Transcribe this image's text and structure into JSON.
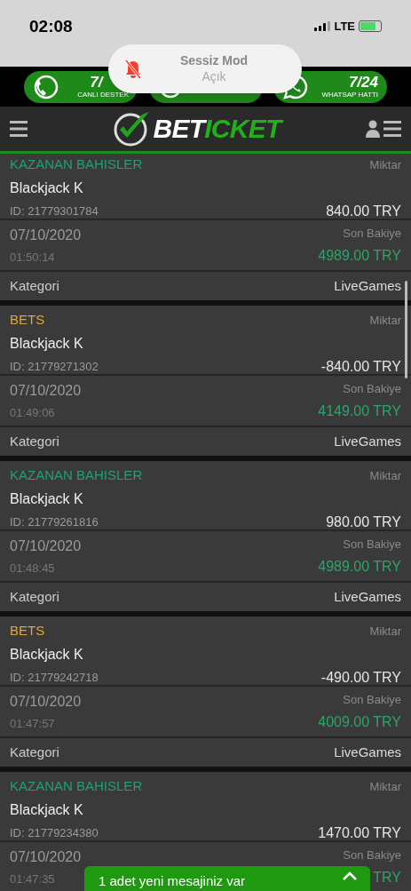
{
  "status_bar": {
    "time": "02:08",
    "network": "LTE"
  },
  "toast": {
    "title": "Sessiz Mod",
    "subtitle": "Açık"
  },
  "promo_bar": [
    {
      "kind": "support",
      "headline": "7/",
      "label": "CANLI DESTEK"
    },
    {
      "kind": "telegram"
    },
    {
      "kind": "whatsapp",
      "headline": "7/24",
      "label": "WHATSAP HATTI"
    }
  ],
  "header": {
    "logo": {
      "part_1": "BET",
      "part_2": "ICKET"
    }
  },
  "transactions": [
    {
      "kind": "win",
      "type": "KAZANAN BAHISLER",
      "amount_label": "Miktar",
      "game": "Blackjack K",
      "id": "ID: 21779301784",
      "amount": "840.00 TRY",
      "date": "07/10/2020",
      "time": "01:50:14",
      "balance_label": "Son Bakiye",
      "balance": "4989.00 TRY",
      "category_label": "Kategori",
      "category": "LiveGames"
    },
    {
      "kind": "bet",
      "type": "BETS",
      "amount_label": "Miktar",
      "game": "Blackjack K",
      "id": "ID: 21779271302",
      "amount": "-840.00 TRY",
      "date": "07/10/2020",
      "time": "01:49:06",
      "balance_label": "Son Bakiye",
      "balance": "4149.00 TRY",
      "category_label": "Kategori",
      "category": "LiveGames"
    },
    {
      "kind": "win",
      "type": "KAZANAN BAHISLER",
      "amount_label": "Miktar",
      "game": "Blackjack K",
      "id": "ID: 21779261816",
      "amount": "980.00 TRY",
      "date": "07/10/2020",
      "time": "01:48:45",
      "balance_label": "Son Bakiye",
      "balance": "4989.00 TRY",
      "category_label": "Kategori",
      "category": "LiveGames"
    },
    {
      "kind": "bet",
      "type": "BETS",
      "amount_label": "Miktar",
      "game": "Blackjack K",
      "id": "ID: 21779242718",
      "amount": "-490.00 TRY",
      "date": "07/10/2020",
      "time": "01:47:57",
      "balance_label": "Son Bakiye",
      "balance": "4009.00 TRY",
      "category_label": "Kategori",
      "category": "LiveGames"
    },
    {
      "kind": "win",
      "type": "KAZANAN BAHISLER",
      "amount_label": "Miktar",
      "game": "Blackjack K",
      "id": "ID: 21779234380",
      "amount": "1470.00 TRY",
      "date": "07/10/2020",
      "time": "01:47:35",
      "balance_label": "Son Bakiye",
      "balance": "TRY"
    }
  ],
  "message_banner": {
    "text": "1 adet yeni mesajiniz var"
  }
}
